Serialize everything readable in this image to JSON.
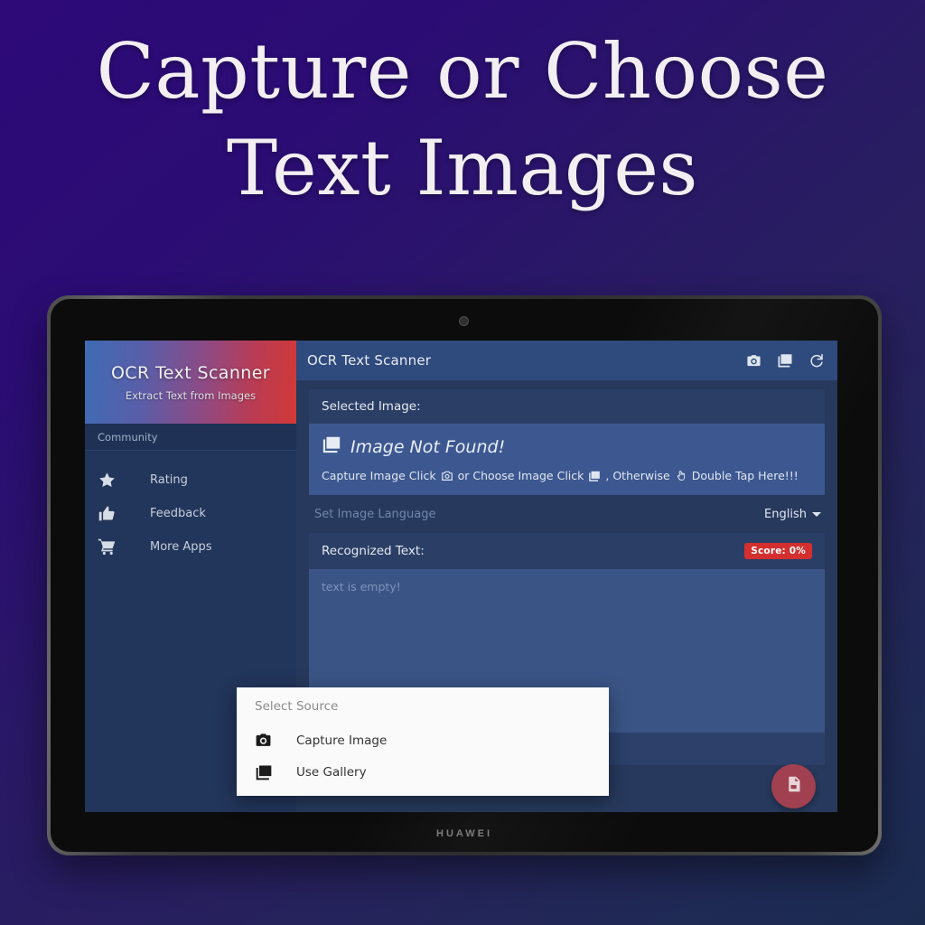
{
  "promo": {
    "line1": "Capture or Choose",
    "line2": "Text Images"
  },
  "device": {
    "brand": "HUAWEI"
  },
  "sidebar": {
    "title": "OCR Text Scanner",
    "subtitle": "Extract Text from Images",
    "section": "Community",
    "items": [
      {
        "label": "Rating",
        "icon": "star-icon"
      },
      {
        "label": "Feedback",
        "icon": "thumbs-up-icon"
      },
      {
        "label": "More Apps",
        "icon": "shopping-cart-icon"
      }
    ]
  },
  "appbar": {
    "title": "OCR Text Scanner",
    "actions": [
      {
        "name": "camera-icon"
      },
      {
        "name": "gallery-icon"
      },
      {
        "name": "refresh-icon"
      }
    ]
  },
  "selected_image": {
    "heading": "Selected Image:",
    "status": "Image Not Found!",
    "hint_part1": "Capture Image Click",
    "hint_part2": "or Choose Image Click",
    "hint_part3": ", Otherwise",
    "hint_part4": "Double Tap Here!!!"
  },
  "language": {
    "label": "Set Image Language",
    "value": "English"
  },
  "recognized": {
    "heading": "Recognized Text:",
    "score_badge": "Score: 0%",
    "placeholder": "text is empty!"
  },
  "bottom": {
    "translate_icon": "translate-icon",
    "fab_icon": "copy-document-icon"
  },
  "dialog": {
    "title": "Select Source",
    "items": [
      {
        "label": "Capture Image",
        "icon": "camera-icon"
      },
      {
        "label": "Use Gallery",
        "icon": "gallery-icon"
      }
    ]
  },
  "colors": {
    "accent_red": "#d32f2f",
    "fab": "#a04050",
    "screen_bg": "#27395c",
    "appbar": "#2f4a7d"
  }
}
